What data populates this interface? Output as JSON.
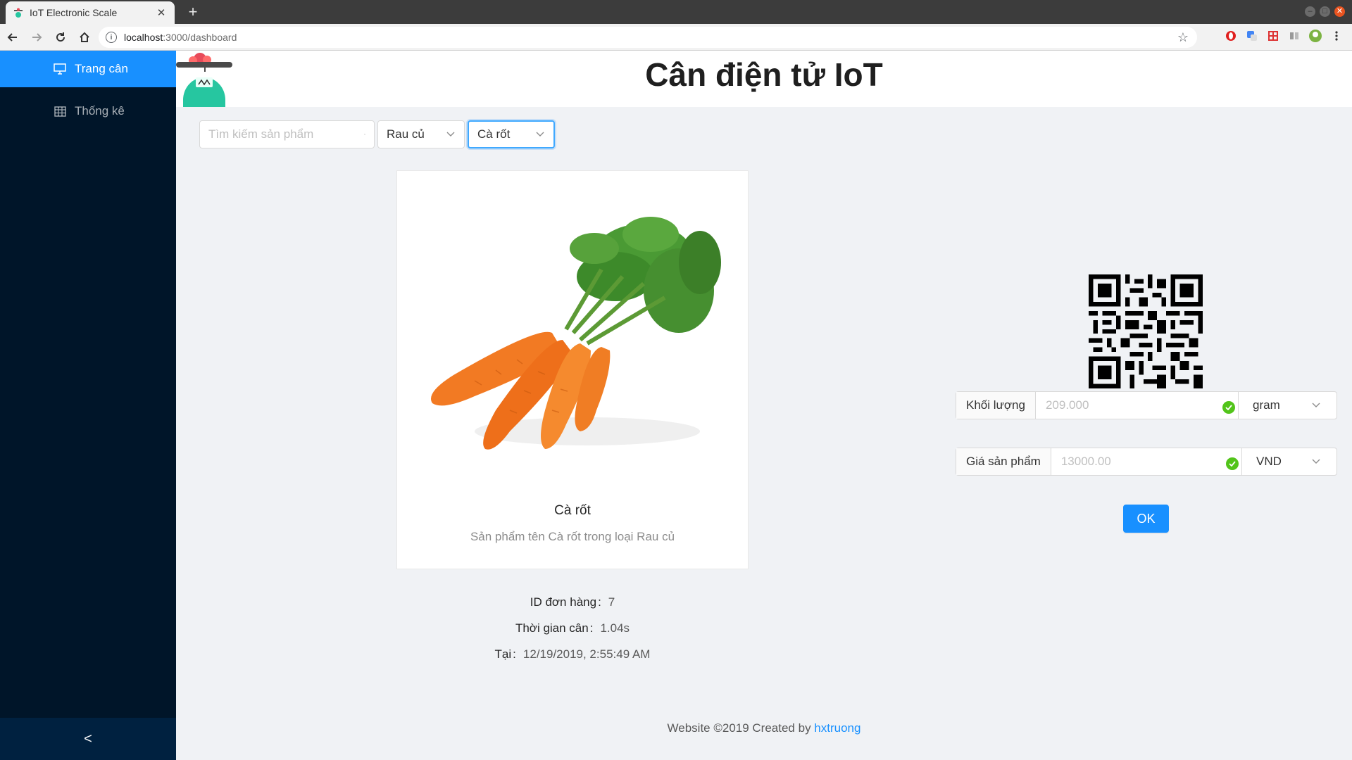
{
  "browser": {
    "tab_title": "IoT Electronic Scale",
    "tab_close": "✕",
    "new_tab": "+",
    "url_host": "localhost",
    "url_path": ":3000/dashboard"
  },
  "sidebar": {
    "items": [
      {
        "label": "Trang cân",
        "icon": "desktop-icon",
        "active": true
      },
      {
        "label": "Thống kê",
        "icon": "table-icon",
        "active": false
      }
    ],
    "collapse_glyph": "<"
  },
  "header": {
    "title": "Cân điện tử IoT"
  },
  "filters": {
    "search_placeholder": "Tìm kiếm sản phẩm",
    "category": "Rau củ",
    "product": "Cà rốt"
  },
  "product": {
    "name": "Cà rốt",
    "description": "Sản phẩm tên Cà rốt trong loại Rau củ"
  },
  "order": {
    "id_label": "ID đơn hàng",
    "id_value": "7",
    "time_label": "Thời gian cân",
    "time_value": "1.04s",
    "at_label": "Tại",
    "at_value": "12/19/2019, 2:55:49 AM",
    "colon": ":"
  },
  "weight": {
    "label": "Khối lượng",
    "value": "209.000",
    "unit": "gram"
  },
  "price": {
    "label": "Giá sản phẩm",
    "value": "13000.00",
    "unit": "VND"
  },
  "ok_label": "OK",
  "footer": {
    "text": "Website ©2019 Created by ",
    "author": "hxtruong"
  },
  "colors": {
    "accent": "#1890ff",
    "sidebar_bg": "#001529",
    "success": "#52c41a"
  }
}
